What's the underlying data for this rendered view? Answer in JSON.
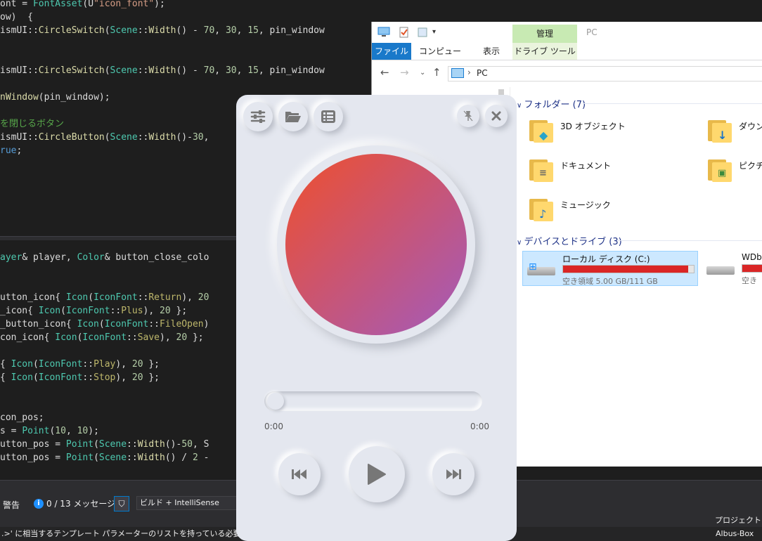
{
  "editor": {
    "lines_top": [
      [
        {
          "t": "ont = ",
          "c": "p"
        },
        {
          "t": "FontAsset",
          "c": "t"
        },
        {
          "t": "(U",
          "c": "p"
        },
        {
          "t": "\"icon_font\"",
          "c": "s"
        },
        {
          "t": ");",
          "c": "p"
        }
      ],
      [
        {
          "t": "ow)  {",
          "c": "p"
        }
      ],
      [
        {
          "t": "ismUI::",
          "c": "p"
        },
        {
          "t": "CircleSwitch",
          "c": "v"
        },
        {
          "t": "(",
          "c": "p"
        },
        {
          "t": "Scene",
          "c": "t"
        },
        {
          "t": "::",
          "c": "p"
        },
        {
          "t": "Width",
          "c": "v"
        },
        {
          "t": "() - ",
          "c": "p"
        },
        {
          "t": "70",
          "c": "n"
        },
        {
          "t": ", ",
          "c": "p"
        },
        {
          "t": "30",
          "c": "n"
        },
        {
          "t": ", ",
          "c": "p"
        },
        {
          "t": "15",
          "c": "n"
        },
        {
          "t": ", pin_window",
          "c": "p"
        }
      ],
      [
        {
          "t": "",
          "c": "p"
        }
      ],
      [
        {
          "t": "",
          "c": "p"
        }
      ],
      [
        {
          "t": "ismUI::",
          "c": "p"
        },
        {
          "t": "CircleSwitch",
          "c": "v"
        },
        {
          "t": "(",
          "c": "p"
        },
        {
          "t": "Scene",
          "c": "t"
        },
        {
          "t": "::",
          "c": "p"
        },
        {
          "t": "Width",
          "c": "v"
        },
        {
          "t": "() - ",
          "c": "p"
        },
        {
          "t": "70",
          "c": "n"
        },
        {
          "t": ", ",
          "c": "p"
        },
        {
          "t": "30",
          "c": "n"
        },
        {
          "t": ", ",
          "c": "p"
        },
        {
          "t": "15",
          "c": "n"
        },
        {
          "t": ", pin_window",
          "c": "p"
        }
      ],
      [
        {
          "t": "",
          "c": "p"
        }
      ],
      [
        {
          "t": "nWindow",
          "c": "v"
        },
        {
          "t": "(pin_window);",
          "c": "p"
        }
      ],
      [
        {
          "t": "",
          "c": "p"
        }
      ],
      [
        {
          "t": "を閉じるボタン",
          "c": "c"
        }
      ],
      [
        {
          "t": "ismUI::",
          "c": "p"
        },
        {
          "t": "CircleButton",
          "c": "v"
        },
        {
          "t": "(",
          "c": "p"
        },
        {
          "t": "Scene",
          "c": "t"
        },
        {
          "t": "::",
          "c": "p"
        },
        {
          "t": "Width",
          "c": "v"
        },
        {
          "t": "()-",
          "c": "p"
        },
        {
          "t": "30",
          "c": "n"
        },
        {
          "t": ",",
          "c": "p"
        }
      ],
      [
        {
          "t": "rue",
          "c": "k"
        },
        {
          "t": ";",
          "c": "p"
        }
      ]
    ],
    "lines_bottom": [
      [
        {
          "t": "ayer",
          "c": "t"
        },
        {
          "t": "& player, ",
          "c": "p"
        },
        {
          "t": "Color",
          "c": "t"
        },
        {
          "t": "& button_close_colo",
          "c": "p"
        }
      ],
      [
        {
          "t": "",
          "c": "p"
        }
      ],
      [
        {
          "t": "",
          "c": "p"
        }
      ],
      [
        {
          "t": "utton_icon{ ",
          "c": "p"
        },
        {
          "t": "Icon",
          "c": "t"
        },
        {
          "t": "(",
          "c": "p"
        },
        {
          "t": "IconFont",
          "c": "t"
        },
        {
          "t": "::",
          "c": "p"
        },
        {
          "t": "Return",
          "c": "m"
        },
        {
          "t": "), ",
          "c": "p"
        },
        {
          "t": "20",
          "c": "n"
        }
      ],
      [
        {
          "t": "_icon{ ",
          "c": "p"
        },
        {
          "t": "Icon",
          "c": "t"
        },
        {
          "t": "(",
          "c": "p"
        },
        {
          "t": "IconFont",
          "c": "t"
        },
        {
          "t": "::",
          "c": "p"
        },
        {
          "t": "Plus",
          "c": "m"
        },
        {
          "t": "), ",
          "c": "p"
        },
        {
          "t": "20",
          "c": "n"
        },
        {
          "t": " };",
          "c": "p"
        }
      ],
      [
        {
          "t": "_button_icon{ ",
          "c": "p"
        },
        {
          "t": "Icon",
          "c": "t"
        },
        {
          "t": "(",
          "c": "p"
        },
        {
          "t": "IconFont",
          "c": "t"
        },
        {
          "t": "::",
          "c": "p"
        },
        {
          "t": "FileOpen",
          "c": "m"
        },
        {
          "t": ")",
          "c": "p"
        }
      ],
      [
        {
          "t": "con_icon{ ",
          "c": "p"
        },
        {
          "t": "Icon",
          "c": "t"
        },
        {
          "t": "(",
          "c": "p"
        },
        {
          "t": "IconFont",
          "c": "t"
        },
        {
          "t": "::",
          "c": "p"
        },
        {
          "t": "Save",
          "c": "m"
        },
        {
          "t": "), ",
          "c": "p"
        },
        {
          "t": "20",
          "c": "n"
        },
        {
          "t": " };",
          "c": "p"
        }
      ],
      [
        {
          "t": "",
          "c": "p"
        }
      ],
      [
        {
          "t": "{ ",
          "c": "p"
        },
        {
          "t": "Icon",
          "c": "t"
        },
        {
          "t": "(",
          "c": "p"
        },
        {
          "t": "IconFont",
          "c": "t"
        },
        {
          "t": "::",
          "c": "p"
        },
        {
          "t": "Play",
          "c": "m"
        },
        {
          "t": "), ",
          "c": "p"
        },
        {
          "t": "20",
          "c": "n"
        },
        {
          "t": " };",
          "c": "p"
        }
      ],
      [
        {
          "t": "{ ",
          "c": "p"
        },
        {
          "t": "Icon",
          "c": "t"
        },
        {
          "t": "(",
          "c": "p"
        },
        {
          "t": "IconFont",
          "c": "t"
        },
        {
          "t": "::",
          "c": "p"
        },
        {
          "t": "Stop",
          "c": "m"
        },
        {
          "t": "), ",
          "c": "p"
        },
        {
          "t": "20",
          "c": "n"
        },
        {
          "t": " };",
          "c": "p"
        }
      ],
      [
        {
          "t": "",
          "c": "p"
        }
      ],
      [
        {
          "t": "",
          "c": "p"
        }
      ],
      [
        {
          "t": "con_pos;",
          "c": "p"
        }
      ],
      [
        {
          "t": "s = ",
          "c": "p"
        },
        {
          "t": "Point",
          "c": "t"
        },
        {
          "t": "(",
          "c": "p"
        },
        {
          "t": "10",
          "c": "n"
        },
        {
          "t": ", ",
          "c": "p"
        },
        {
          "t": "10",
          "c": "n"
        },
        {
          "t": ");",
          "c": "p"
        }
      ],
      [
        {
          "t": "utton_pos = ",
          "c": "p"
        },
        {
          "t": "Point",
          "c": "t"
        },
        {
          "t": "(",
          "c": "p"
        },
        {
          "t": "Scene",
          "c": "t"
        },
        {
          "t": "::",
          "c": "p"
        },
        {
          "t": "Width",
          "c": "v"
        },
        {
          "t": "()-",
          "c": "p"
        },
        {
          "t": "50",
          "c": "n"
        },
        {
          "t": ", S",
          "c": "p"
        }
      ],
      [
        {
          "t": "utton_pos = ",
          "c": "p"
        },
        {
          "t": "Point",
          "c": "t"
        },
        {
          "t": "(",
          "c": "p"
        },
        {
          "t": "Scene",
          "c": "t"
        },
        {
          "t": "::",
          "c": "p"
        },
        {
          "t": "Width",
          "c": "v"
        },
        {
          "t": "() / ",
          "c": "p"
        },
        {
          "t": "2",
          "c": "n"
        },
        {
          "t": " -",
          "c": "p"
        }
      ]
    ]
  },
  "error_list": {
    "warnings_label": "警告",
    "messages_label": "0 / 13 メッセージ",
    "build_filter": "ビルド + IntelliSense",
    "project_column": "プロジェクト"
  },
  "status_bar": {
    "message": ".>' に相当するテンプレート パラメーターのリストを持っている必要があります",
    "project_name": "Albus-Box"
  },
  "explorer": {
    "window_title": "PC",
    "tabs": {
      "file": "ファイル",
      "computer": "コンピューター",
      "view": "表示",
      "drive_tools": "ドライブ ツール"
    },
    "manage_tab": "管理",
    "address": "PC",
    "folders_header": "フォルダー (7)",
    "folders": [
      {
        "name": "3D オブジェクト",
        "icon": "3d-objects-icon"
      },
      {
        "name": "ダウンロ",
        "icon": "downloads-icon"
      },
      {
        "name": "ドキュメント",
        "icon": "documents-icon"
      },
      {
        "name": "ピクチャ",
        "icon": "pictures-icon"
      },
      {
        "name": "ミュージック",
        "icon": "music-icon"
      }
    ],
    "drives_header": "デバイスとドライブ (3)",
    "drives": [
      {
        "name": "ローカル ディスク (C:)",
        "free": "空き領域 5.00 GB/111 GB",
        "used_fraction": 0.955
      },
      {
        "name": "WDbl",
        "free": "空き",
        "used_fraction": 0.9
      }
    ],
    "accent_color": "#1979ca",
    "drive_full_color": "#da2626"
  },
  "player": {
    "time_current": "0:00",
    "time_total": "0:00",
    "seek_fraction": 0,
    "art_gradient": [
      "#ef4f2c",
      "#a25bbd"
    ],
    "icons": [
      "settings-sliders-icon",
      "folder-open-icon",
      "playlist-icon",
      "pin-icon",
      "close-icon",
      "previous-track-icon",
      "play-icon",
      "next-track-icon"
    ]
  }
}
